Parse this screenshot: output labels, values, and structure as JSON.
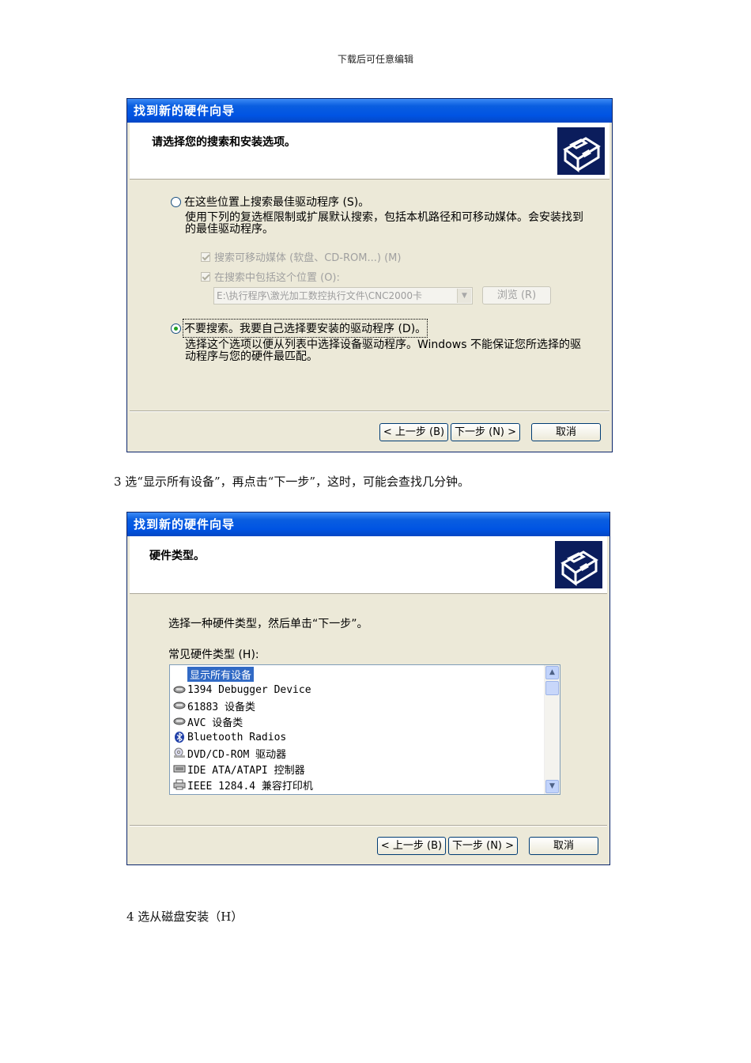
{
  "header": {
    "text": "下载后可任意编辑"
  },
  "wizard1": {
    "title": "找到新的硬件向导",
    "heading": "请选择您的搜索和安装选项。",
    "option_search": "在这些位置上搜索最佳驱动程序 (S)。",
    "option_search_desc": "使用下列的复选框限制或扩展默认搜索，包括本机路径和可移动媒体。会安装找到的最佳驱动程序。",
    "check_removable": "搜索可移动媒体 (软盘、CD-ROM...) (M)",
    "check_include": "在搜索中包括这个位置 (O):",
    "path_value": "E:\\执行程序\\激光加工数控执行文件\\CNC2000卡",
    "browse_label": "浏览 (R)",
    "option_nosearch": "不要搜索。我要自己选择要安装的驱动程序 (D)。",
    "option_nosearch_desc": "选择这个选项以便从列表中选择设备驱动程序。Windows 不能保证您所选择的驱动程序与您的硬件最匹配。",
    "back_label": "< 上一步 (B)",
    "next_label": "下一步 (N) >",
    "cancel_label": "取消"
  },
  "step3": {
    "text": "3    选“显示所有设备”，再点击“下一步”，这时，可能会查找几分钟。"
  },
  "wizard2": {
    "title": "找到新的硬件向导",
    "heading": "硬件类型。",
    "instruction": "选择一种硬件类型，然后单击“下一步”。",
    "list_label": "常见硬件类型 (H):",
    "items": [
      {
        "label": "显示所有设备",
        "icon": "none",
        "selected": true
      },
      {
        "label": "1394 Debugger Device",
        "icon": "device-icon"
      },
      {
        "label": "61883 设备类",
        "icon": "device-icon"
      },
      {
        "label": "AVC 设备类",
        "icon": "device-icon"
      },
      {
        "label": "Bluetooth Radios",
        "icon": "bluetooth-icon"
      },
      {
        "label": "DVD/CD-ROM 驱动器",
        "icon": "cdrom-icon"
      },
      {
        "label": "IDE ATA/ATAPI 控制器",
        "icon": "ide-icon"
      },
      {
        "label": "IEEE 1284.4 兼容打印机",
        "icon": "printer-icon"
      }
    ],
    "back_label": "< 上一步 (B)",
    "next_label": "下一步 (N) >",
    "cancel_label": "取消"
  },
  "step4": {
    "text": "4    选从磁盘安装（H）"
  }
}
